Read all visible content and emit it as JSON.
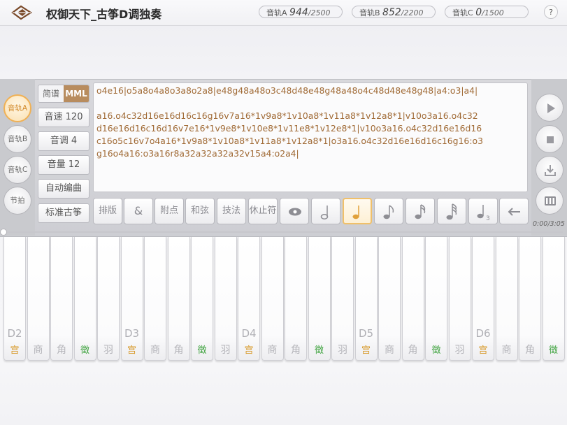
{
  "header": {
    "title": "权御天下_古筝D调独奏",
    "tracks": [
      {
        "label": "音轨A",
        "count": "944",
        "total": "/2500"
      },
      {
        "label": "音轨B",
        "count": "852",
        "total": "/2200"
      },
      {
        "label": "音轨C",
        "count": "0",
        "total": "/1500"
      }
    ],
    "help_label": "?"
  },
  "left_tracks": [
    {
      "label": "音轨A",
      "active": true
    },
    {
      "label": "音轨B",
      "active": false
    },
    {
      "label": "音轨C",
      "active": false
    },
    {
      "label": "节拍",
      "active": false
    }
  ],
  "options": {
    "notation_a": "简谱",
    "notation_b": "MML",
    "tempo": "音速 120",
    "key": "音调 4",
    "volume": "音量 12",
    "auto_compose": "自动编曲",
    "instrument": "标准古筝"
  },
  "editor": {
    "lines": [
      "o4e16|o5a8o4a8o3a8o2a8|e48g48a48o3c48d48e48g48a48o4c48d48e48g48|a4:o3|a4|",
      "",
      "a16.o4c32d16e16d16c16g16v7a16*1v9a8*1v10a8*1v11a8*1v12a8*1|v10o3a16.o4c32",
      "d16e16d16c16d16v7e16*1v9e8*1v10e8*1v11e8*1v12e8*1|v10o3a16.o4c32d16e16d16",
      "c16o5c16v7o4a16*1v9a8*1v10a8*1v11a8*1v12a8*1|o3a16.o4c32d16e16d16c16g16:o3",
      "g16o4a16:o3a16r8a32a32a32a32v15a4:o2a4|"
    ]
  },
  "toolbar": {
    "layout": "排版",
    "amp": "&",
    "dot": "附点",
    "chord": "和弦",
    "technique": "技法",
    "rest": "休止符"
  },
  "playback": {
    "time": "0:00/3:05",
    "progress": 0.0
  },
  "keyboard": {
    "keys": [
      {
        "oct": "D2",
        "note": "宫",
        "kind": "gong"
      },
      {
        "oct": "",
        "note": "商",
        "kind": "plain"
      },
      {
        "oct": "",
        "note": "角",
        "kind": "plain"
      },
      {
        "oct": "",
        "note": "徵",
        "kind": "zhi"
      },
      {
        "oct": "",
        "note": "羽",
        "kind": "plain"
      },
      {
        "oct": "D3",
        "note": "宫",
        "kind": "gong"
      },
      {
        "oct": "",
        "note": "商",
        "kind": "plain"
      },
      {
        "oct": "",
        "note": "角",
        "kind": "plain"
      },
      {
        "oct": "",
        "note": "徵",
        "kind": "zhi"
      },
      {
        "oct": "",
        "note": "羽",
        "kind": "plain"
      },
      {
        "oct": "D4",
        "note": "宫",
        "kind": "gong"
      },
      {
        "oct": "",
        "note": "商",
        "kind": "plain"
      },
      {
        "oct": "",
        "note": "角",
        "kind": "plain"
      },
      {
        "oct": "",
        "note": "徵",
        "kind": "zhi"
      },
      {
        "oct": "",
        "note": "羽",
        "kind": "plain"
      },
      {
        "oct": "D5",
        "note": "宫",
        "kind": "gong"
      },
      {
        "oct": "",
        "note": "商",
        "kind": "plain"
      },
      {
        "oct": "",
        "note": "角",
        "kind": "plain"
      },
      {
        "oct": "",
        "note": "徵",
        "kind": "zhi"
      },
      {
        "oct": "",
        "note": "羽",
        "kind": "plain"
      },
      {
        "oct": "D6",
        "note": "宫",
        "kind": "gong"
      },
      {
        "oct": "",
        "note": "商",
        "kind": "plain"
      },
      {
        "oct": "",
        "note": "角",
        "kind": "plain"
      },
      {
        "oct": "",
        "note": "徵",
        "kind": "zhi"
      }
    ]
  },
  "colors": {
    "accent": "#f0b155",
    "mml_bg": "#b88c5e",
    "gong": "#d89a2a",
    "zhi": "#3fa33f",
    "code_text": "#a06a35"
  },
  "icons": [
    "logo-icon",
    "eye-icon",
    "whole-note-icon",
    "half-note-icon",
    "quarter-note-icon",
    "eighth-note-icon",
    "sixteenth-note-icon",
    "triplet-note-icon",
    "backspace-icon",
    "play-icon",
    "stop-icon",
    "download-icon",
    "keyboard-icon"
  ]
}
